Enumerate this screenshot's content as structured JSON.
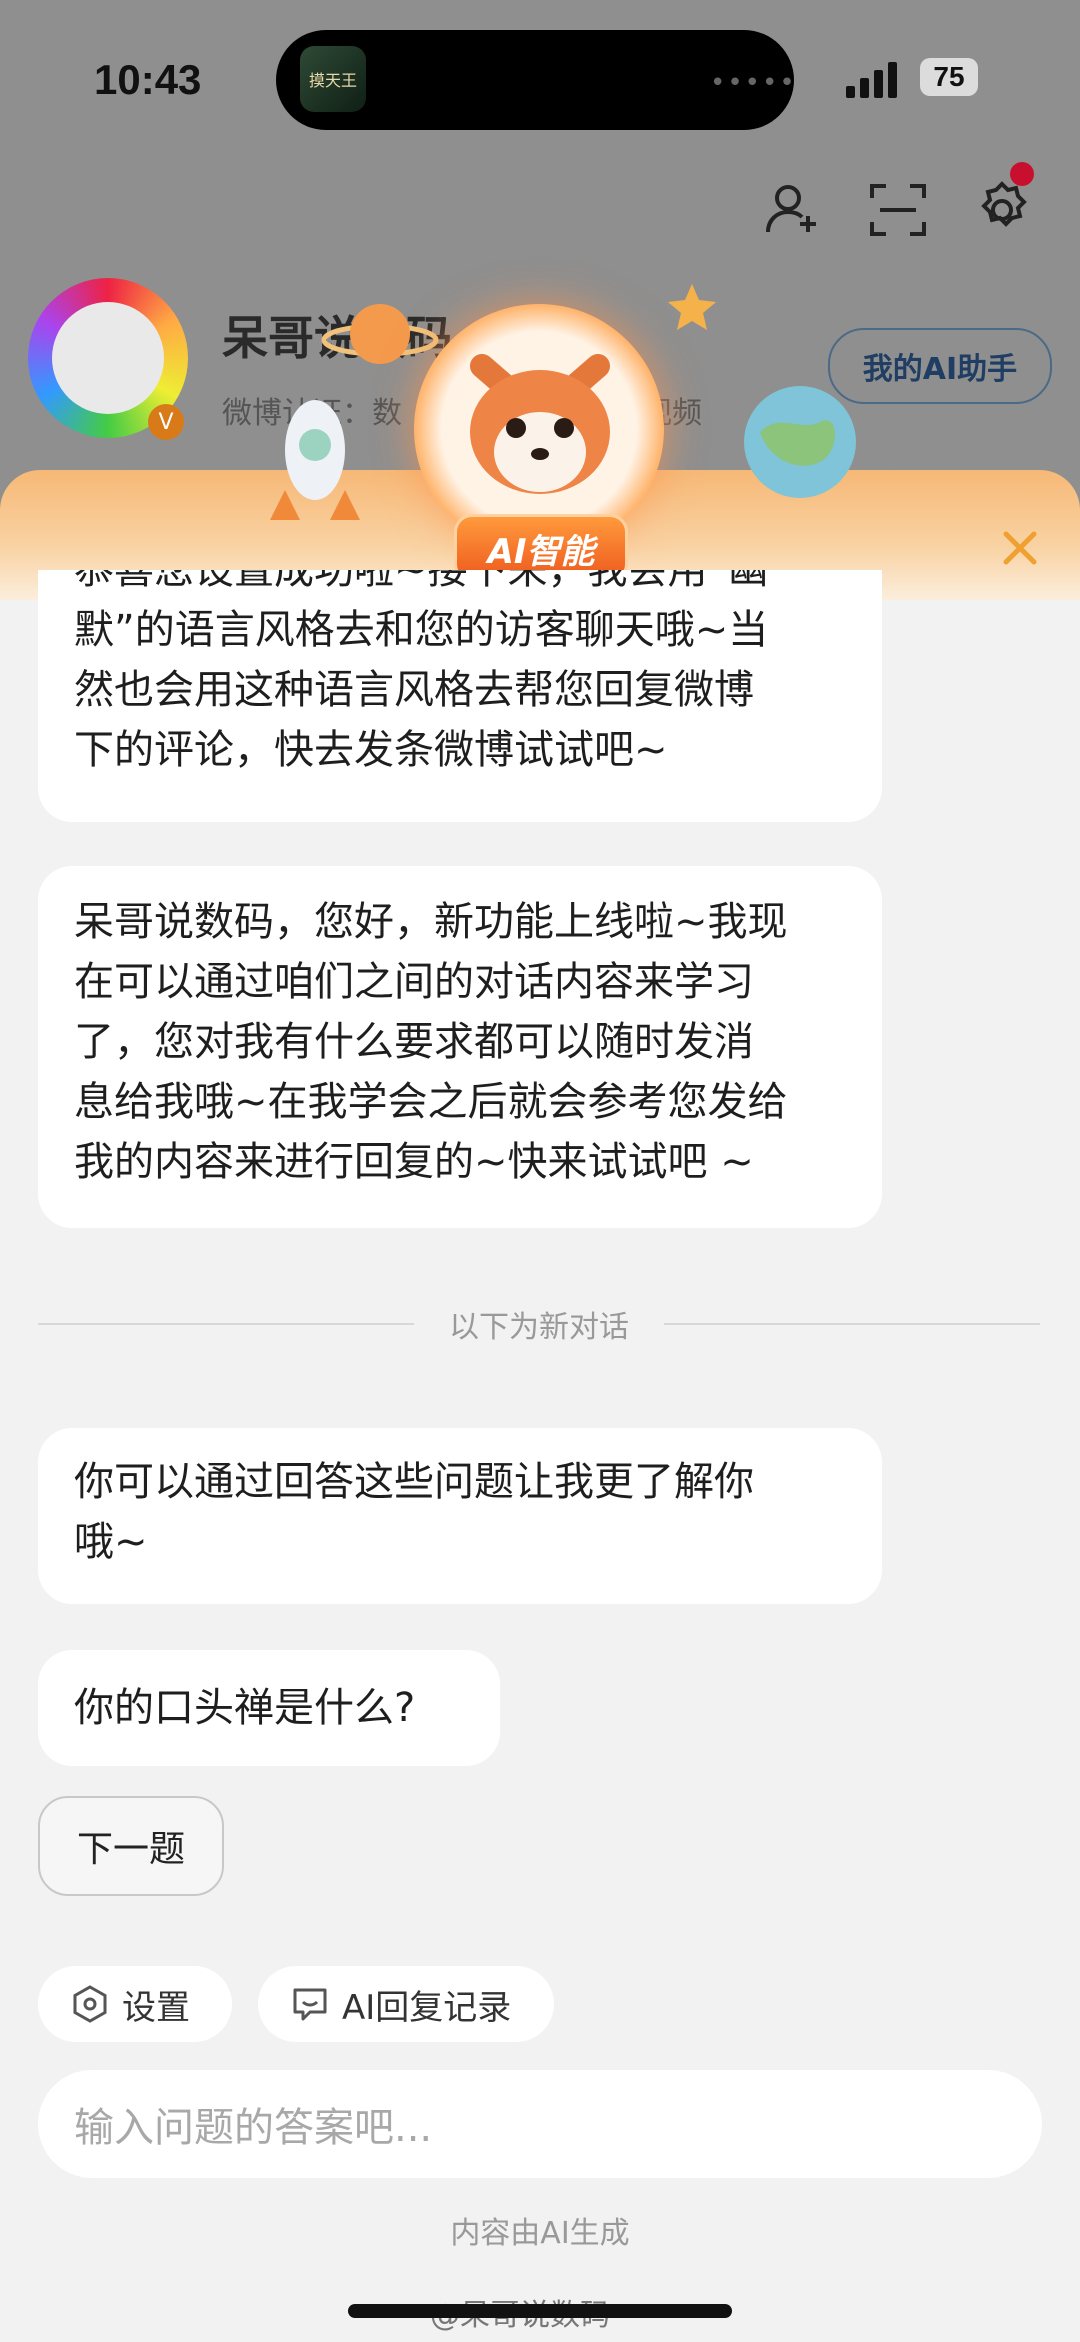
{
  "status_bar": {
    "time": "10:43",
    "battery": "75",
    "island_app": "摸天王",
    "island_dots": "•••••"
  },
  "header": {
    "name": "呆哥说数码",
    "cert_prefix": "微博认证：数",
    "cert_suffix": "视频",
    "ai_button": "我的AI助手"
  },
  "banner": {
    "badge": "AI智能"
  },
  "chat": {
    "partial_line1": "恭喜您设置成功啦~接下来，我会用“幽",
    "partial_rest": [
      "默”的语言风格去和您的访客聊天哦~当",
      "然也会用这种语言风格去帮您回复微博",
      "下的评论，快去发条微博试试吧~"
    ],
    "message2": [
      "呆哥说数码，您好，新功能上线啦~我现",
      "在可以通过咱们之间的对话内容来学习",
      "了，您对我有什么要求都可以随时发消",
      "息给我哦~在我学会之后就会参考您发给",
      "我的内容来进行回复的~快来试试吧 ~"
    ],
    "divider": "以下为新对话",
    "message3": [
      "你可以通过回答这些问题让我更了解你",
      "哦~"
    ],
    "question": "你的口头禅是什么?",
    "next_button": "下一题"
  },
  "chips": {
    "settings": "设置",
    "records": "AI回复记录"
  },
  "input": {
    "placeholder": "输入问题的答案吧..."
  },
  "footer": {
    "ai_generated": "内容由AI生成",
    "watermark": "@呆哥说数码"
  },
  "colors": {
    "accent_orange": "#ee5a1e",
    "badge_red": "#c8102e",
    "ai_button_text": "#203e63"
  }
}
